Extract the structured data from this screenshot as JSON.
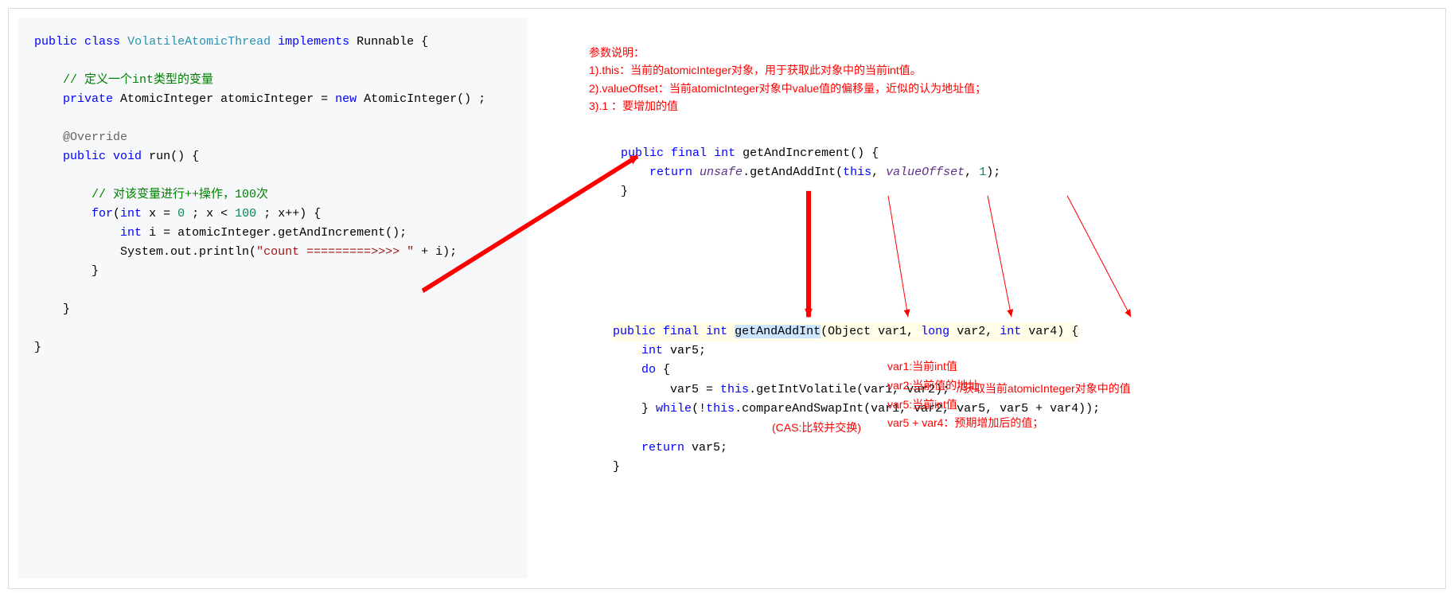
{
  "left": {
    "l1a": "public",
    "l1b": "class",
    "l1c": "VolatileAtomicThread",
    "l1d": "implements",
    "l1e": "Runnable {",
    "c1": "// 定义一个",
    "c1b": "int",
    "c1c": "类型的变量",
    "l2a": "private",
    "l2b": "AtomicInteger atomicInteger =",
    "l2c": "new",
    "l2d": "AtomicInteger() ;",
    "ov": "@Override",
    "l3a": "public",
    "l3b": "void",
    "l3c": "run() {",
    "c2": "// 对该变量进行++操作，100次",
    "l4a": "for",
    "l4b": "(",
    "l4c": "int",
    "l4d": "x =",
    "l4n0": "0",
    "l4e": "; x <",
    "l4n100": "100",
    "l4f": "; x++) {",
    "l5a": "int",
    "l5b": "i = atomicInteger.getAndIncrement();",
    "l6a": "System.out.println(",
    "l6b": "\"count =========>>>> \"",
    "l6c": " + i);",
    "rb": "}"
  },
  "right_annot": {
    "title": "参数说明：",
    "l1": "1).this：当前的atomicInteger对象，用于获取此对象中的当前int值。",
    "l2": "2).valueOffset：当前atomicInteger对象中value值的偏移量，近似的认为地址值；",
    "l3": "3).1 ：要增加的值"
  },
  "mid": {
    "m1a": "public",
    "m1b": "final",
    "m1c": "int",
    "m1d": "getAndIncrement() {",
    "m2a": "return",
    "m2b": "unsafe",
    "m2c": ".getAndAddInt(",
    "m2d": "this",
    "m2e": ",",
    "m2f": "valueOffset",
    "m2g": ",",
    "m2h": "1",
    "m2i": ");",
    "cb": "}"
  },
  "bot": {
    "b1a": "public",
    "b1b": "final",
    "b1c": "int",
    "b1d": "getAndAddInt",
    "b1e": "(Object var1,",
    "b1f": "long",
    "b1g": "var2,",
    "b1h": "int",
    "b1i": "var4) {",
    "b2a": "int",
    "b2b": "var5;",
    "b3a": "do",
    "b3b": "{",
    "b4a": "var5 =",
    "b4b": "this",
    "b4c": ".getIntVolatile(var1, var2);",
    "b4d": "//获取当前atomicInteger对象中的值",
    "b5a": "}",
    "b5b": "while",
    "b5c": "(!",
    "b5d": "this",
    "b5e": ".compareAndSwapInt(var1, var2, var5, var5 + var4));",
    "b6": "(CAS:比较并交换)",
    "b7a": "return",
    "b7b": "var5;",
    "cb": "}"
  },
  "vars": {
    "v1": "var1:当前int值",
    "v2": "var2:当前值的地址",
    "v3": "var5:当前int值",
    "v4": "var5 + var4：预期增加后的值；"
  }
}
